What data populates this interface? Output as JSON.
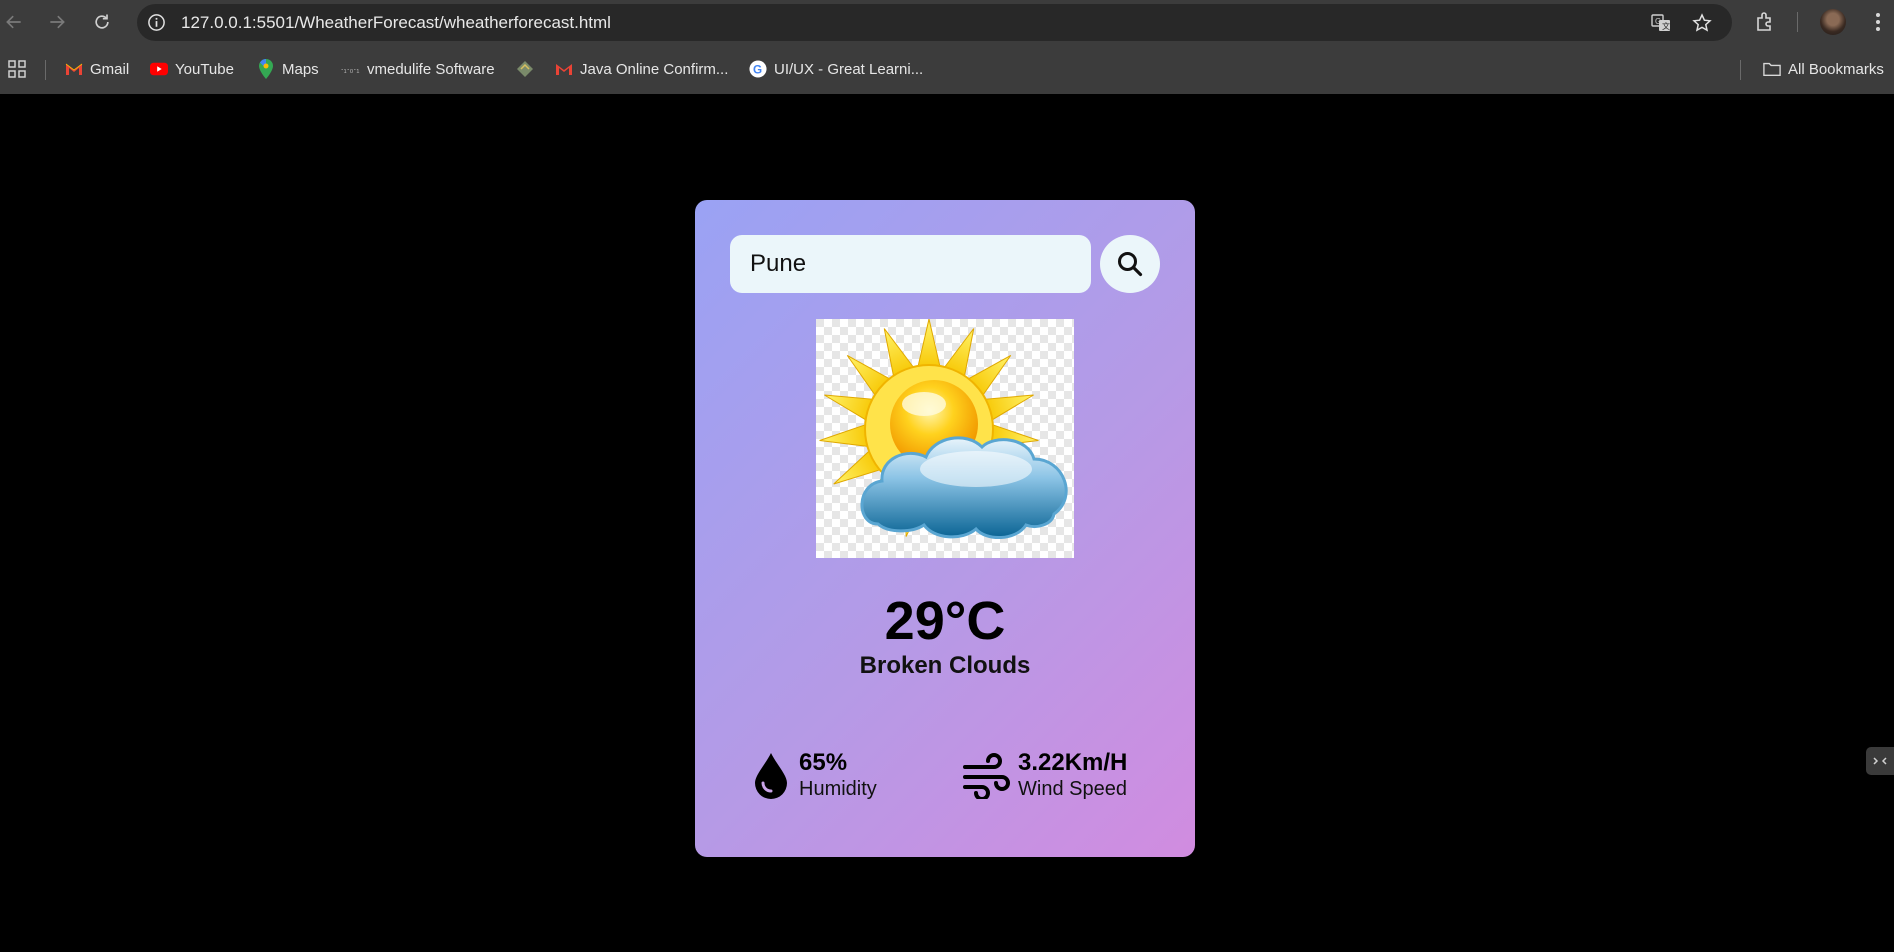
{
  "browser": {
    "url": "127.0.0.1:5501/WheatherForecast/wheatherforecast.html",
    "bookmarks": [
      {
        "label": "Gmail",
        "icon": "gmail-icon"
      },
      {
        "label": "YouTube",
        "icon": "youtube-icon"
      },
      {
        "label": "Maps",
        "icon": "maps-icon"
      },
      {
        "label": "vmedulife Software",
        "icon": "vmedulife-icon"
      },
      {
        "label": "",
        "icon": "bookmark-app-icon"
      },
      {
        "label": "Java Online Confirm...",
        "icon": "gmail-icon"
      },
      {
        "label": "UI/UX - Great Learni...",
        "icon": "google-icon"
      }
    ],
    "all_bookmarks_label": "All Bookmarks"
  },
  "weather": {
    "city_value": "Pune",
    "temperature": "29°C",
    "condition": "Broken Clouds",
    "humidity_value": "65%",
    "humidity_label": "Humidity",
    "wind_value": "3.22Km/H",
    "wind_label": "Wind Speed"
  },
  "colors": {
    "card_gradient_start": "#9aa2f4",
    "card_gradient_end": "#d18ce0",
    "input_bg": "#ebf6fa",
    "page_bg": "#000000"
  }
}
